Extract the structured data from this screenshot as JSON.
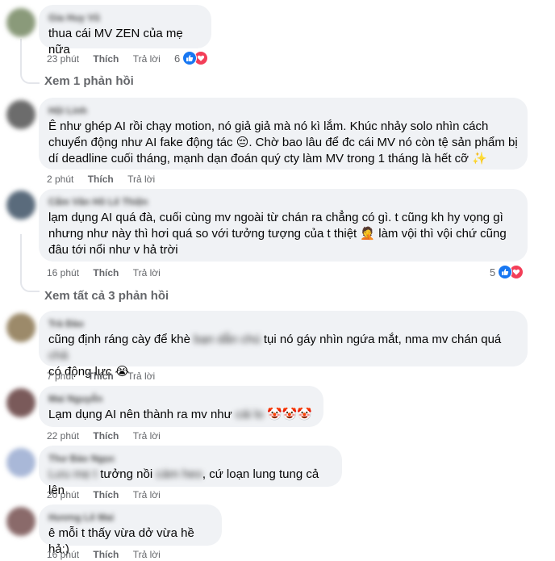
{
  "colors": {
    "bubble": "#f0f2f5",
    "meta_text": "#65676b",
    "like_blue": "#1877f2",
    "love_red": "#f33e58",
    "thread_line": "#e4e6eb"
  },
  "comments": [
    {
      "author": "Gia Huy Vũ",
      "lines": [
        "thua cái MV ZEN của mẹ nữa"
      ],
      "time": "23 phút",
      "like": "Thích",
      "reply": "Trả lời",
      "reactions": {
        "count": "6",
        "icons": [
          "like-icon",
          "love-icon"
        ]
      }
    },
    {
      "author": "Hội Linh",
      "lines": [
        "Ê như ghép AI rồi chạy motion, nó giả giả mà nó kì lắm. Khúc nhảy solo nhìn cách",
        "chuyển động như AI fake động tác 😔. Chờ bao lâu để đc cái MV nó còn tệ sản phẩm bị",
        "dí deadline cuối tháng, mạnh dạn đoán quý cty làm MV trong 1 tháng là hết cỡ ✨"
      ],
      "time": "2 phút",
      "like": "Thích",
      "reply": "Trả lời"
    },
    {
      "author": "Cẩm Vân Hồ Lê Thiện",
      "lines": [
        "lạm dụng AI quá đà, cuối cùng mv ngoài từ chán ra chẳng có gì. t cũng kh hy vọng gì",
        "nhưng như này thì hơi quá so với tưởng tượng của t thiệt 🤦 làm vội thì vội chứ cũng",
        "đâu tới nổi như v hả trời"
      ],
      "time": "16 phút",
      "like": "Thích",
      "reply": "Trả lời",
      "reactions": {
        "count": "5",
        "icons": [
          "like-icon",
          "love-icon"
        ]
      }
    },
    {
      "author": "Trà Đào",
      "line1_before": "cũng định ráng cày để khè ",
      "line1_blur": "bạn dẫn chú",
      "line1_after": " tụi nó gáy nhìn ngứa mắt, nma mv chán quá ",
      "line1_blur2": "chả",
      "line2": "có động lực 😭",
      "time": "7 phút",
      "like": "Thích",
      "reply": "Trả lời"
    },
    {
      "author": "Mai Nguyễn",
      "text_before": "Lạm dụng AI nên thành ra mv như ",
      "text_blur": "cái lo",
      "text_after": " 🤡🤡🤡",
      "time": "22 phút",
      "like": "Thích",
      "reply": "Trả lời"
    },
    {
      "author": "Thư Bảo Ngọc",
      "blur_start": "Lưu mẹ t",
      "text": " tưởng nồi ",
      "blur_mid": "cám heo",
      "text_after": ", cứ loạn lung tung cả lên",
      "time": "20 phút",
      "like": "Thích",
      "reply": "Trả lời"
    },
    {
      "author": "Hương Lê Mai",
      "lines": [
        "ê mỗi t thấy vừa dở vừa hề hả:)"
      ],
      "time": "16 phút",
      "like": "Thích",
      "reply": "Trả lời"
    }
  ],
  "view_replies": [
    {
      "label": "Xem 1 phản hồi"
    },
    {
      "label": "Xem tất cả 3 phản hồi"
    }
  ]
}
